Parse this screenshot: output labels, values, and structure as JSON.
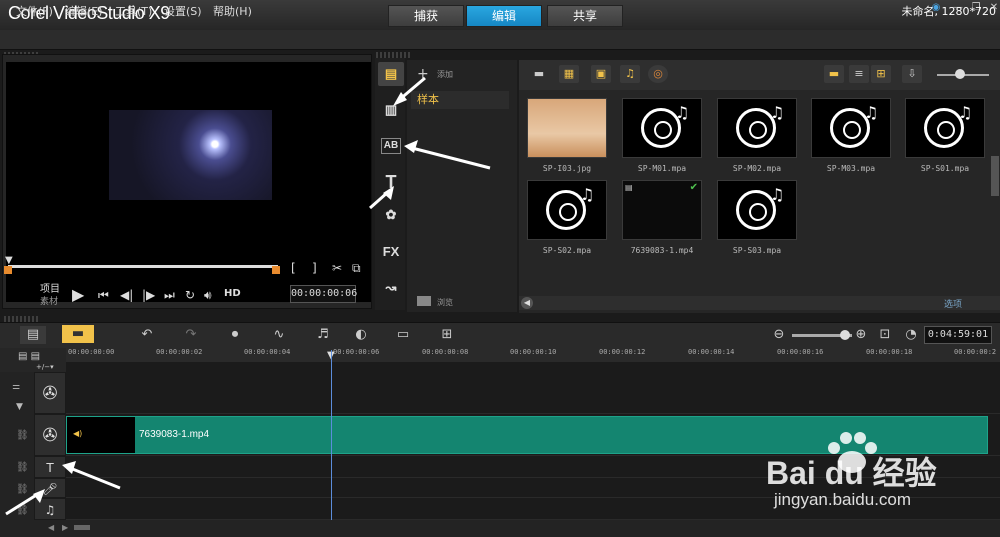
{
  "app": {
    "title": "Corel VideoStudio X9"
  },
  "mode_tabs": [
    {
      "label": "捕获"
    },
    {
      "label": "编辑"
    },
    {
      "label": "共享"
    }
  ],
  "menu": [
    {
      "label": "文件(F)"
    },
    {
      "label": "编辑(E)"
    },
    {
      "label": "工具(T)"
    },
    {
      "label": "设置(S)"
    },
    {
      "label": "帮助(H)"
    }
  ],
  "project_info": "未命名, 1280*720",
  "player": {
    "mode_project": "项目",
    "mode_clip": "素材",
    "quality": "HD",
    "timecode": "00:00:00:06"
  },
  "folders": {
    "add_label": "添加",
    "sample": "样本",
    "browse_label": "浏览"
  },
  "library": {
    "options_label": "选项",
    "items": [
      {
        "name": "SP-I03.jpg",
        "kind": "image"
      },
      {
        "name": "SP-M01.mpa",
        "kind": "audio"
      },
      {
        "name": "SP-M02.mpa",
        "kind": "audio"
      },
      {
        "name": "SP-M03.mpa",
        "kind": "audio"
      },
      {
        "name": "SP-S01.mpa",
        "kind": "audio"
      },
      {
        "name": "SP-S02.mpa",
        "kind": "audio"
      },
      {
        "name": "7639083-1.mp4",
        "kind": "video"
      },
      {
        "name": "SP-S03.mpa",
        "kind": "audio"
      }
    ]
  },
  "timeline": {
    "duration": "0:04:59:01",
    "ruler": [
      "00:00:00:00",
      "00:00:00:02",
      "00:00:00:04",
      "00:00:00:06",
      "00:00:00:08",
      "00:00:00:10",
      "00:00:00:12",
      "00:00:00:14",
      "00:00:00:16",
      "00:00:00:18",
      "00:00:00:2"
    ],
    "clip_name": "7639083-1.mp4"
  },
  "watermark": {
    "brand": "Bai du 经验",
    "url": "jingyan.baidu.com"
  }
}
